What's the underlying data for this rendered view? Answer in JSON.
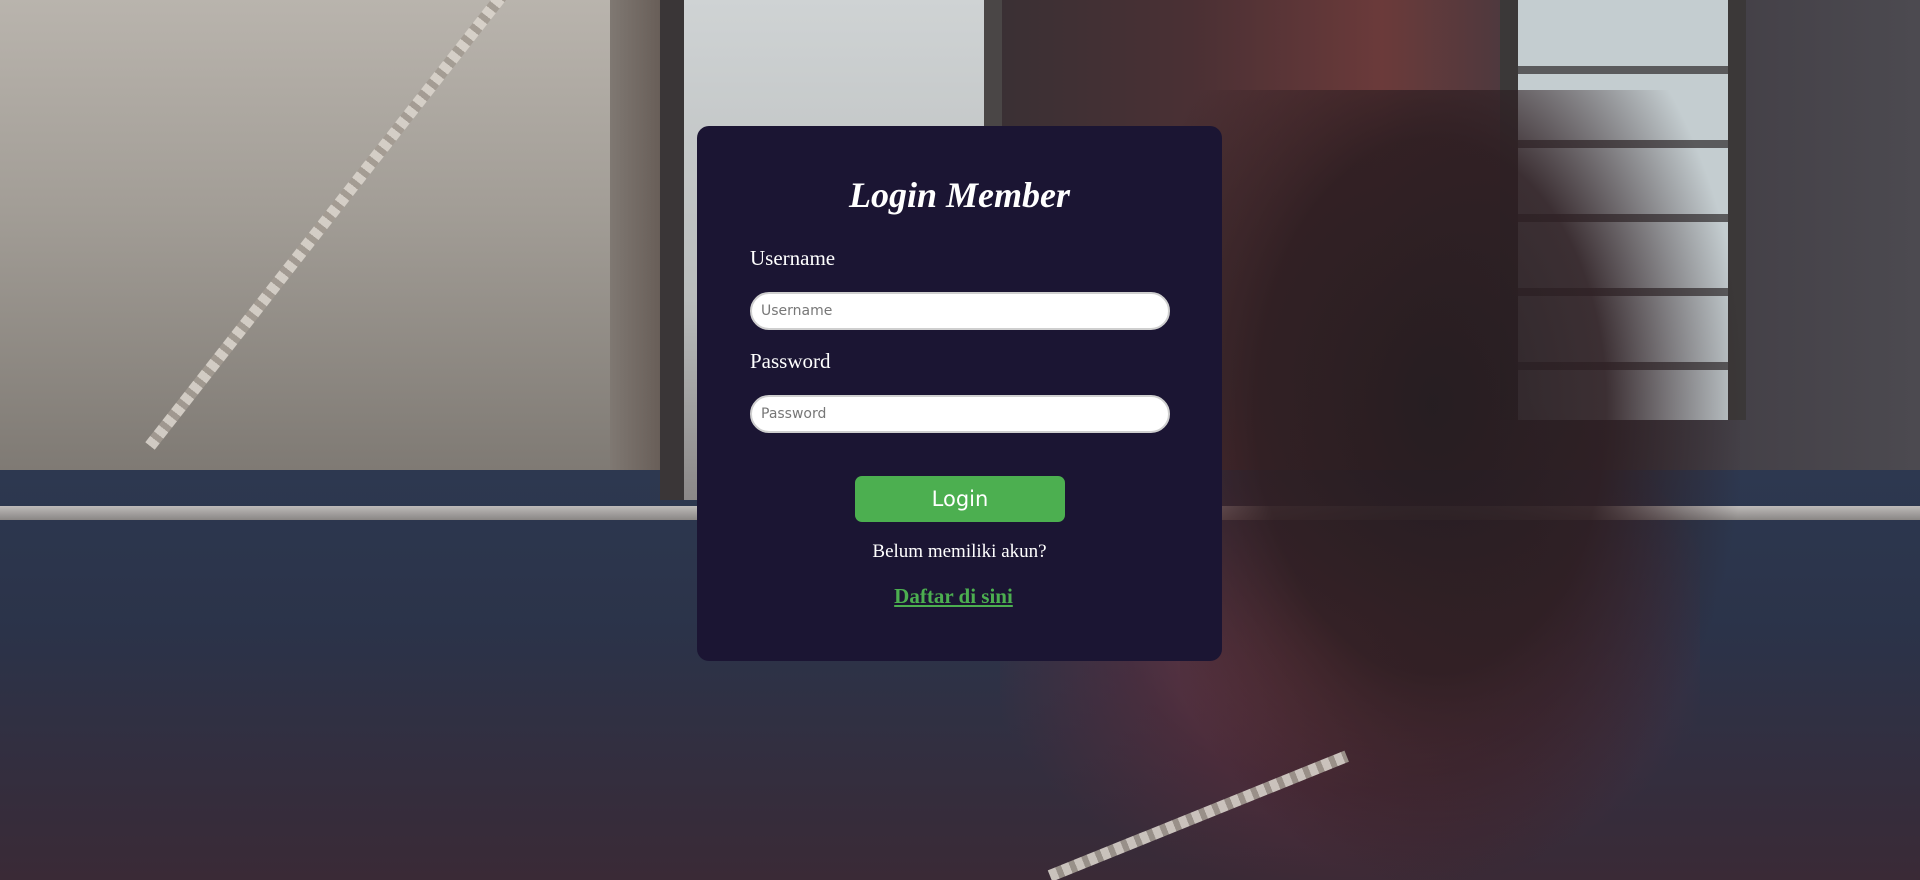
{
  "login": {
    "title": "Login Member",
    "username_label": "Username",
    "username_placeholder": "Username",
    "password_label": "Password",
    "password_placeholder": "Password",
    "submit_label": "Login",
    "register_prompt": "Belum memiliki akun?",
    "register_link": "Daftar di sini"
  },
  "colors": {
    "card_background": "#1b1533",
    "button_green": "#4caf50",
    "link_green": "#4caf50"
  }
}
